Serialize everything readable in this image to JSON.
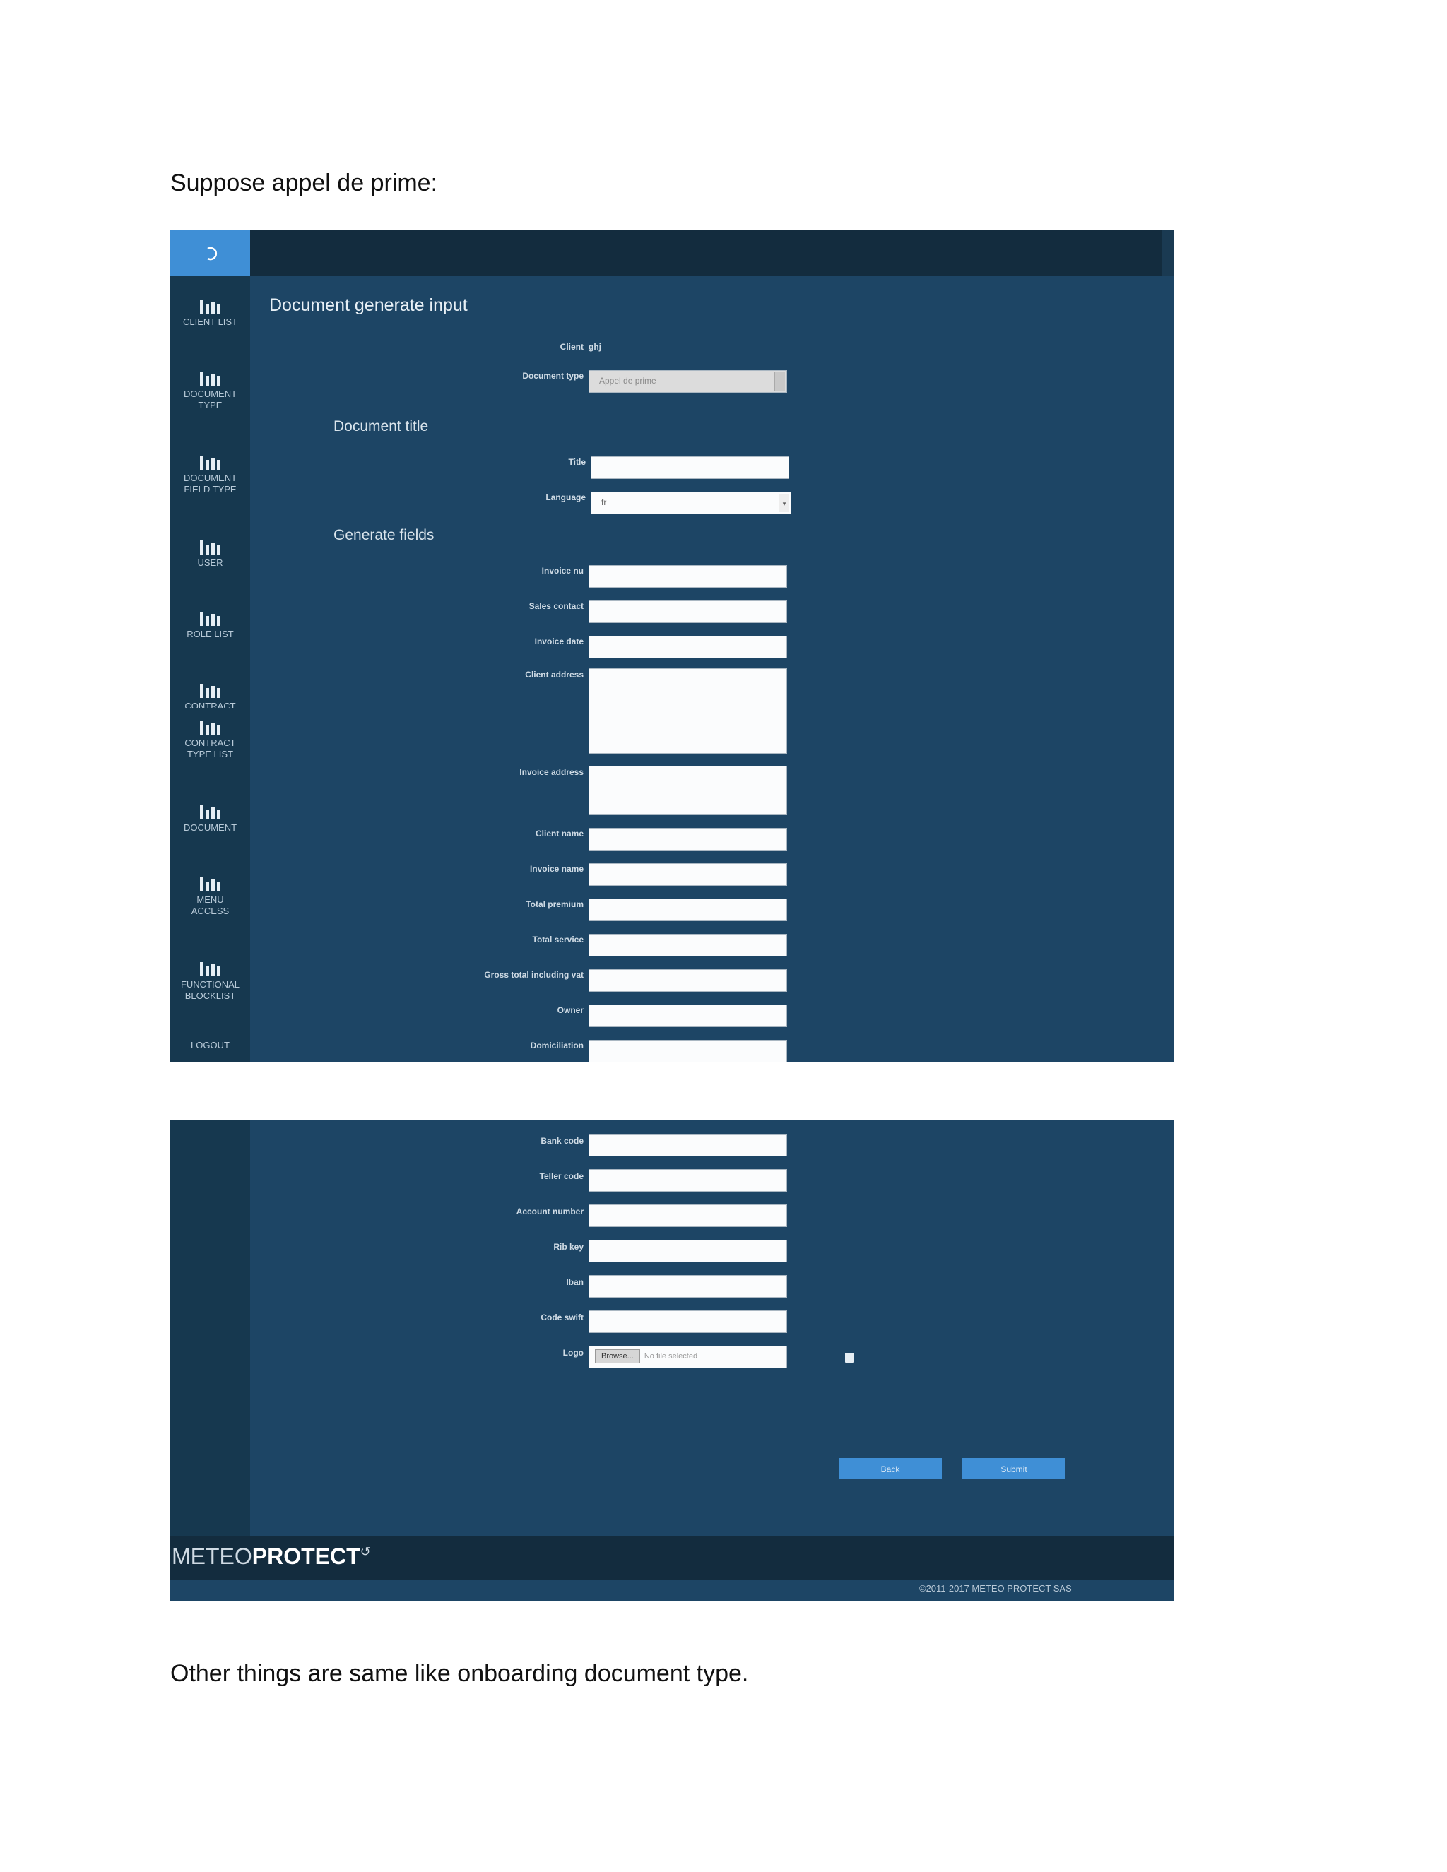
{
  "intro_text": "Suppose appel de prime:",
  "outro_text": "Other things are same like onboarding document type.",
  "sidebar": {
    "items": [
      {
        "label": "CLIENT LIST"
      },
      {
        "label": "DOCUMENT\nTYPE"
      },
      {
        "label": "DOCUMENT\nFIELD TYPE"
      },
      {
        "label": "USER"
      },
      {
        "label": "ROLE LIST"
      },
      {
        "label": "CONTRACT"
      },
      {
        "label": "CONTRACT\nTYPE LIST"
      },
      {
        "label": "DOCUMENT"
      },
      {
        "label": "MENU\nACCESS"
      },
      {
        "label": "FUNCTIONAL\nBLOCKLIST"
      }
    ],
    "logout": "LOGOUT"
  },
  "form": {
    "title": "Document generate input",
    "client_label": "Client",
    "client_value": "ghj",
    "doctype_label": "Document type",
    "doctype_value": "Appel de prime",
    "section_title": "Document title",
    "title_label": "Title",
    "language_label": "Language",
    "language_value": "fr",
    "section_fields": "Generate fields",
    "fields": [
      {
        "label": "Invoice nu"
      },
      {
        "label": "Sales contact"
      },
      {
        "label": "Invoice date"
      },
      {
        "label": "Client address"
      },
      {
        "label": "Invoice address"
      },
      {
        "label": "Client name"
      },
      {
        "label": "Invoice name"
      },
      {
        "label": "Total premium"
      },
      {
        "label": "Total service"
      },
      {
        "label": "Gross total including vat"
      },
      {
        "label": "Owner"
      },
      {
        "label": "Domiciliation"
      }
    ],
    "fields_more": [
      {
        "label": "Bank code"
      },
      {
        "label": "Teller code"
      },
      {
        "label": "Account number"
      },
      {
        "label": "Rib key"
      },
      {
        "label": "Iban"
      },
      {
        "label": "Code swift"
      }
    ],
    "logo_label": "Logo",
    "browse_label": "Browse...",
    "file_status": "No file selected",
    "back_button": "Back",
    "submit_button": "Submit"
  },
  "footer": {
    "logo_light": "METEO",
    "logo_bold": "PROTECT",
    "copyright": "©2011-2017 METEO PROTECT SAS"
  },
  "colors": {
    "panel": "#1d4565",
    "sidebar": "#16384f",
    "header": "#132c3e",
    "accent": "#3f8fd6"
  }
}
